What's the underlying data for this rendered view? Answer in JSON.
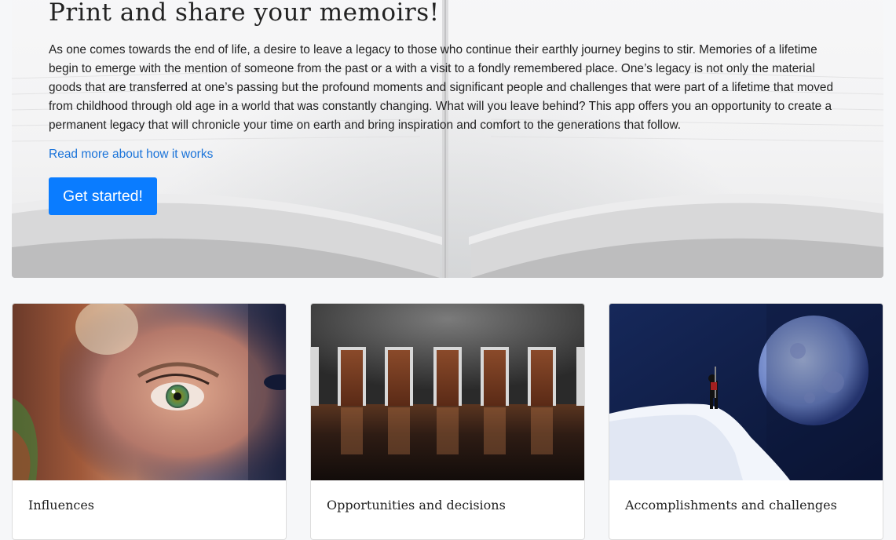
{
  "hero": {
    "title": "Print and share your memoirs!",
    "description": "As one comes towards the end of life, a desire to leave a legacy to those who continue their earthly journey begins to stir. Memories of a lifetime begin to emerge with the mention of someone from the past or a with a visit to a fondly remembered place. One’s legacy is not only the material goods that are transferred at one’s passing but the profound moments and significant people and challenges that were part of a lifetime that moved from childhood through old age in a world that was constantly changing. What will you leave behind? This app offers you an opportunity to create a permanent legacy that will chronicle your time on earth and bring inspiration and comfort to the generations that follow.",
    "link_label": "Read more about how it works",
    "button_label": "Get started!",
    "accent_color": "#0a7cff",
    "link_color": "#1a73d9"
  },
  "cards": [
    {
      "title": "Influences",
      "image": "child-eye-photo"
    },
    {
      "title": "Opportunities and decisions",
      "image": "doors-hallway-photo"
    },
    {
      "title": "Accomplishments and challenges",
      "image": "mountain-climber-moon-photo"
    }
  ]
}
